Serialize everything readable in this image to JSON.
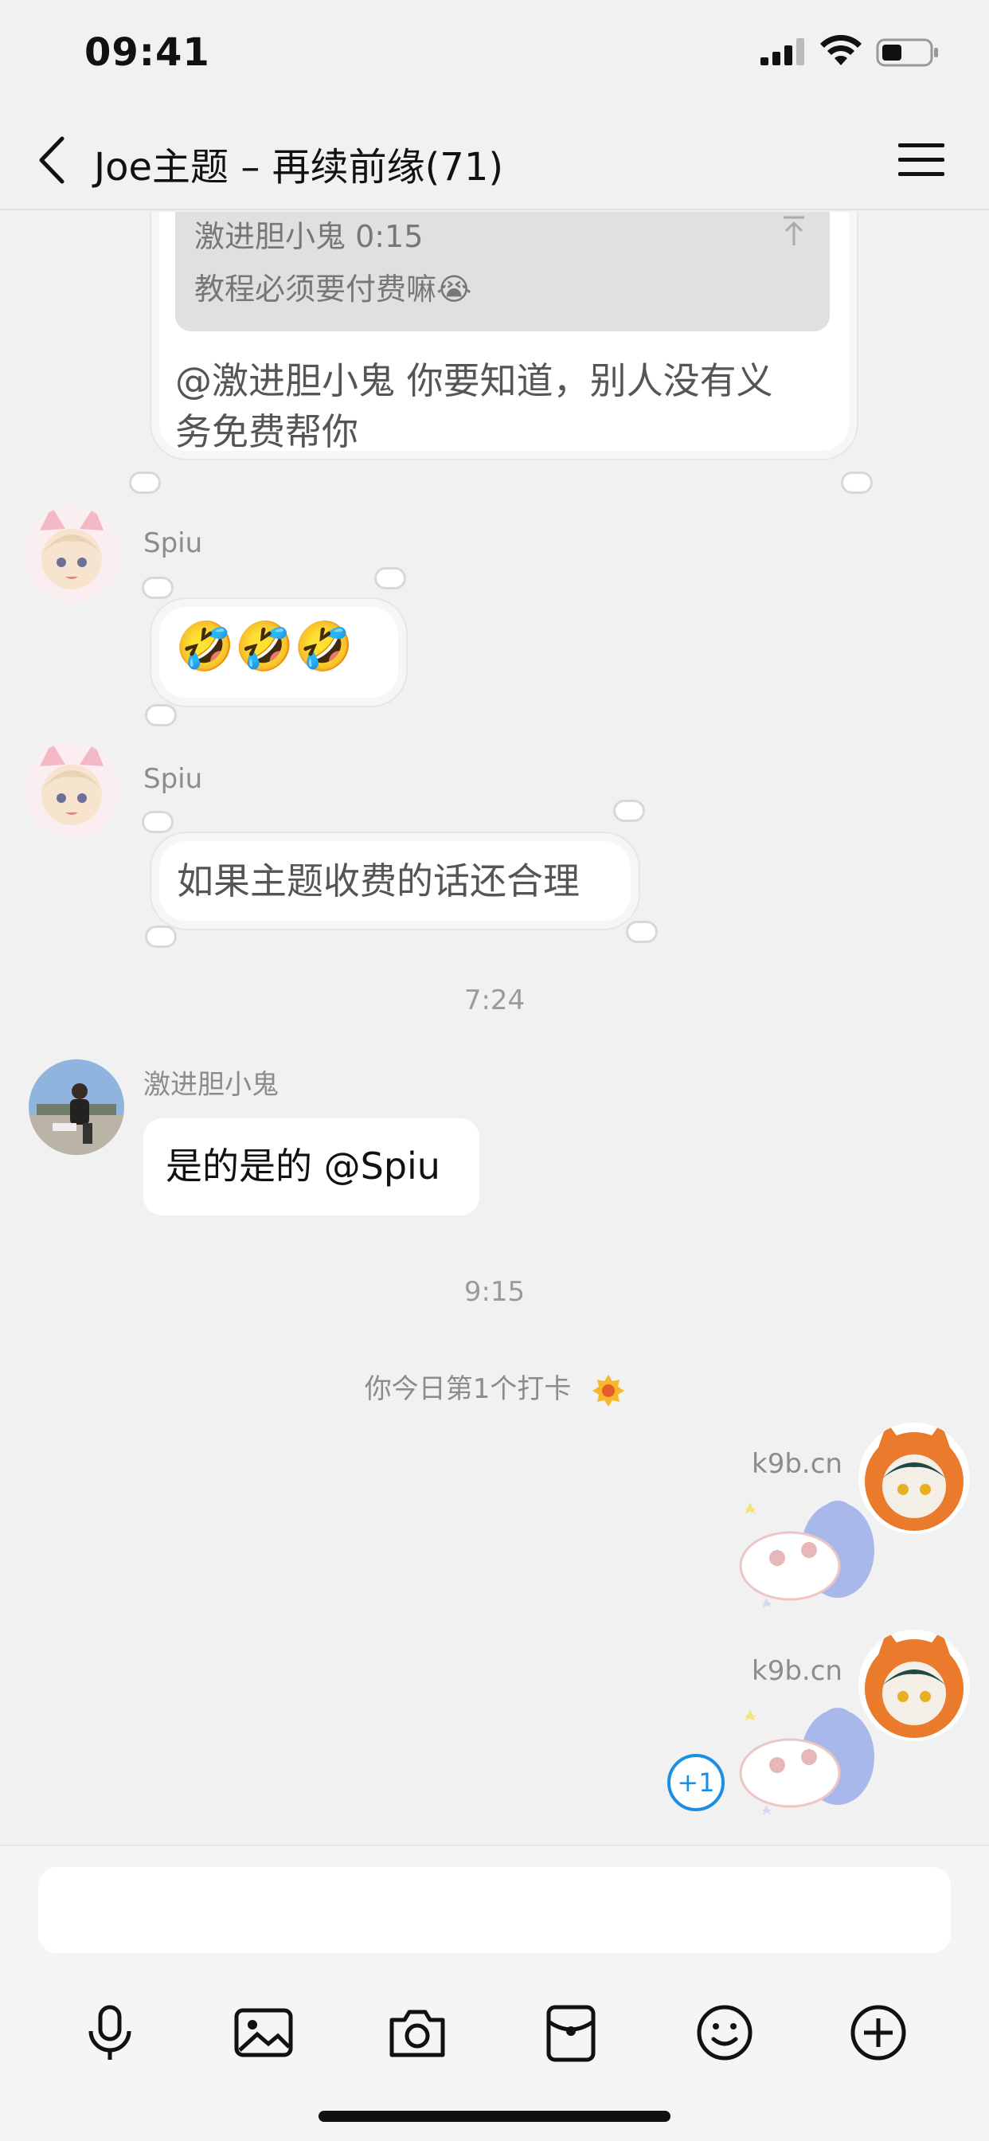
{
  "status_bar": {
    "time": "09:41"
  },
  "nav": {
    "title": "Joe主题 – 再续前缘(71)"
  },
  "quoted_message": {
    "quote_sender": "激进胆小鬼 0:15",
    "quote_text": "教程必须要付费嘛😭",
    "reply_text_line1": "@激进胆小鬼 你要知道，别人没有义",
    "reply_text_line2": "务免费帮你"
  },
  "messages": [
    {
      "sender": "Spiu",
      "text": "🤣🤣🤣"
    },
    {
      "sender": "Spiu",
      "text": "如果主题收费的话还合理"
    },
    {
      "sender": "激进胆小鬼",
      "text": "是的是的 @Spiu"
    }
  ],
  "time_separators": [
    "7:24",
    "9:15"
  ],
  "checkin": {
    "text": "你今日第1个打卡"
  },
  "stickers": [
    {
      "label": "k9b.cn"
    },
    {
      "label": "k9b.cn"
    }
  ],
  "plus_one": "+1",
  "input": {
    "value": "",
    "placeholder": ""
  },
  "toolbar": [
    "microphone-icon",
    "image-icon",
    "camera-icon",
    "red-packet-icon",
    "emoji-icon",
    "plus-icon"
  ],
  "colors": {
    "background": "#f1f1f1",
    "accent": "#1a8fe3",
    "bubble": "#ffffff"
  }
}
